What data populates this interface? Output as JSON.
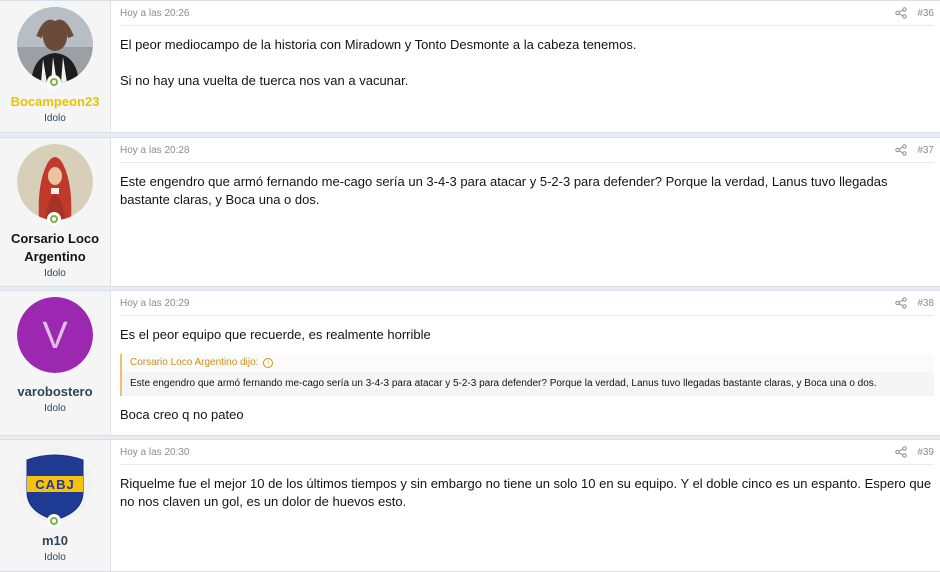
{
  "posts": [
    {
      "author": "Bocampeon23",
      "author_color": "#e5c400",
      "user_title": "Idolo",
      "avatar_icon": "photo-avatar",
      "time": "Hoy a las 20:26",
      "number": "#36",
      "paragraphs": [
        "El peor mediocampo de la historia con Miradown y Tonto Desmonte a la cabeza tenemos.",
        "Si no hay una vuelta de tuerca nos van a vacunar."
      ]
    },
    {
      "author": "Corsario Loco Argentino",
      "author_color": "#141414",
      "user_title": "Idolo",
      "avatar_icon": "painting-avatar",
      "time": "Hoy a las 20:28",
      "number": "#37",
      "paragraphs": [
        "Este engendro que armó fernando me-cago sería un 3-4-3 para atacar y 5-2-3 para defender? Porque la verdad, Lanus tuvo llegadas bastante claras, y Boca una o dos."
      ]
    },
    {
      "author": "varobostero",
      "author_color": "#2b485c",
      "user_title": "Idolo",
      "avatar_letter": "V",
      "avatar_color": "#9c27b0",
      "time": "Hoy a las 20:29",
      "number": "#38",
      "paragraphs_before": [
        "Es el peor equipo que recuerde, es realmente horrible"
      ],
      "quote": {
        "header": "Corsario Loco Argentino dijo:",
        "text": "Este engendro que armó fernando me-cago sería un 3-4-3 para atacar y 5-2-3 para defender? Porque la verdad, Lanus tuvo llegadas bastante claras, y Boca una o dos."
      },
      "paragraphs_after": [
        "Boca creo q no pateo"
      ]
    },
    {
      "author": "m10",
      "author_color": "#2b485c",
      "user_title": "Idolo",
      "avatar_text": "CABJ",
      "time": "Hoy a las 20:30",
      "number": "#39",
      "paragraphs": [
        "Riquelme fue el mejor 10 de los últimos tiempos y sin embargo no tiene un solo 10 en su equipo. Y el doble cinco es un espanto. Espero que no nos claven un gol, es un dolor de huevos esto."
      ]
    }
  ]
}
